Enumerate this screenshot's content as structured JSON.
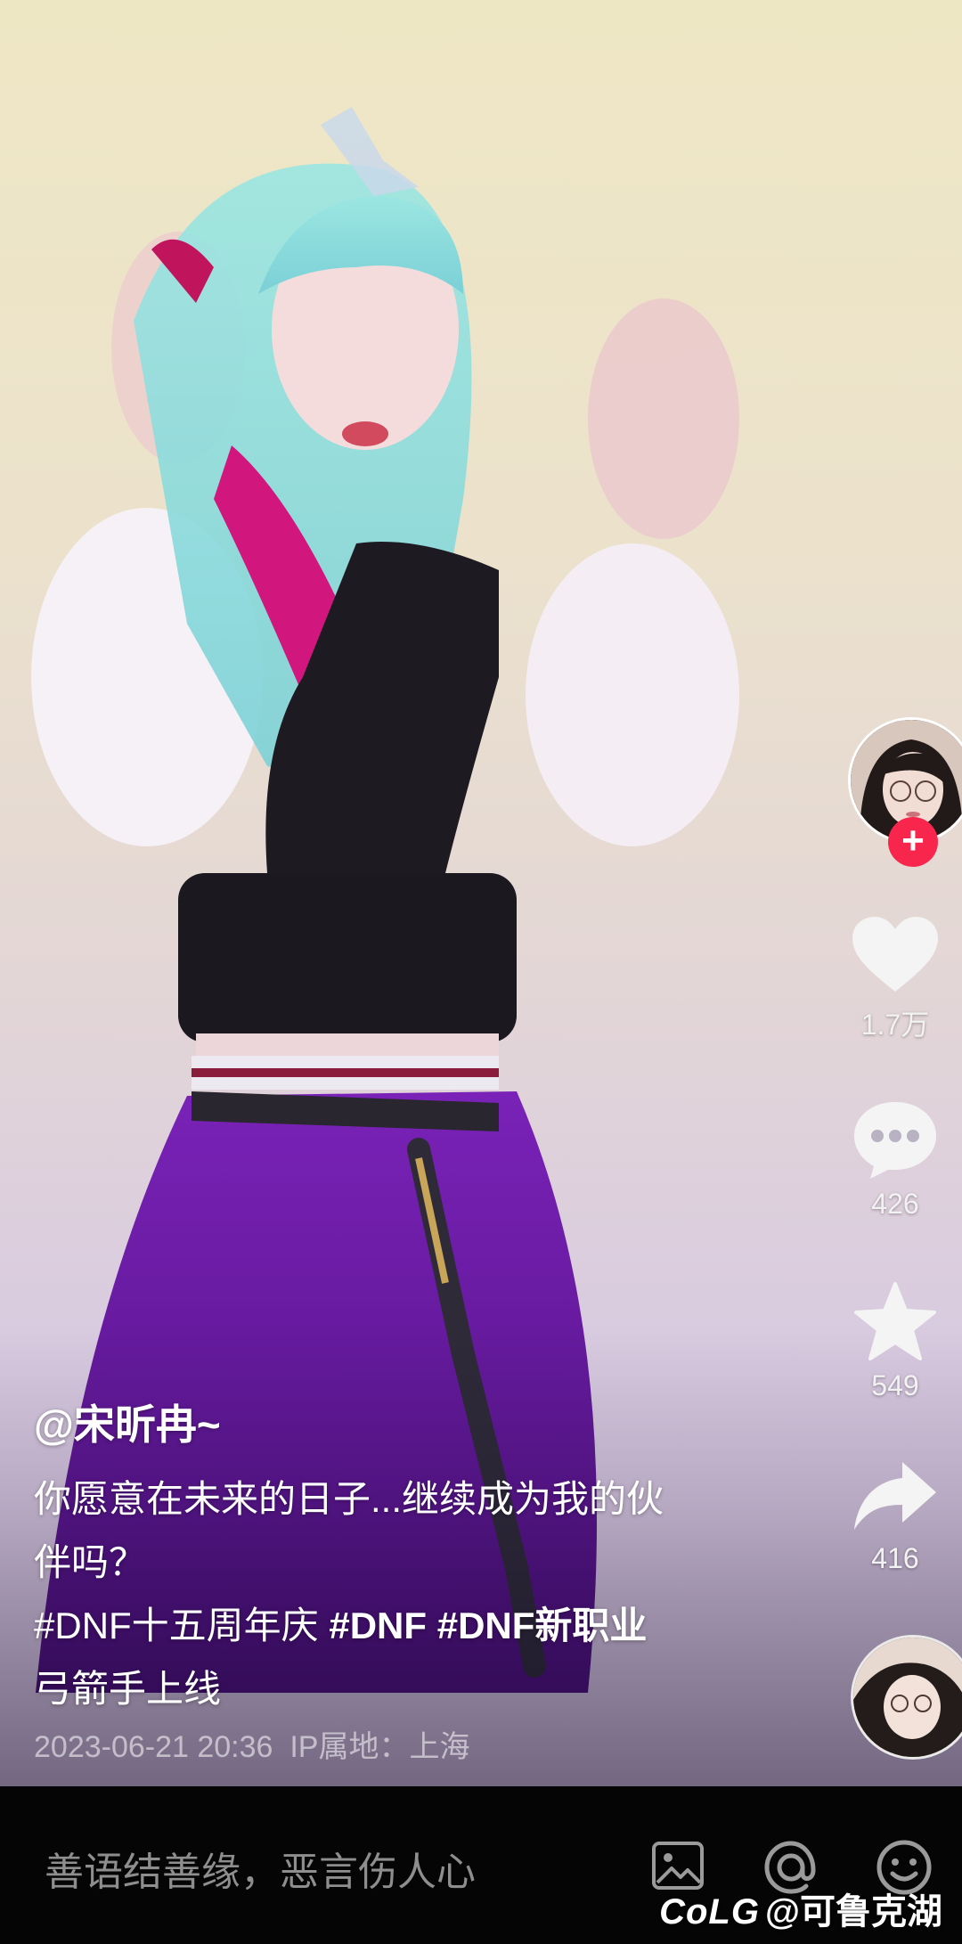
{
  "video": {
    "author": "@宋昕冉~",
    "description_line1": "你愿意在未来的日子...继续成为我的伙",
    "description_line2": "伴吗？",
    "hashtags": [
      {
        "text": "#DNF十五周年庆",
        "bold": false
      },
      {
        "text": "#DNF",
        "bold": true
      },
      {
        "text": "#DNF新职业",
        "bold": true
      }
    ],
    "description_line4": "弓箭手上线",
    "date": "2023-06-21 20:36",
    "ip_location": "IP属地：上海"
  },
  "actions": {
    "follow_symbol": "+",
    "likes": "1.7万",
    "comments": "426",
    "favorites": "549",
    "shares": "416"
  },
  "comment_bar": {
    "placeholder": "善语结善缘，恶言伤人心",
    "image_icon": "image-icon",
    "mention_icon": "at-mention-icon",
    "emoji_icon": "emoji-icon"
  },
  "watermark": {
    "logo": "CoLG",
    "text": "@可鲁克湖"
  },
  "colors": {
    "follow_badge": "#f8264d",
    "icon_white": "#f4f4f4"
  }
}
